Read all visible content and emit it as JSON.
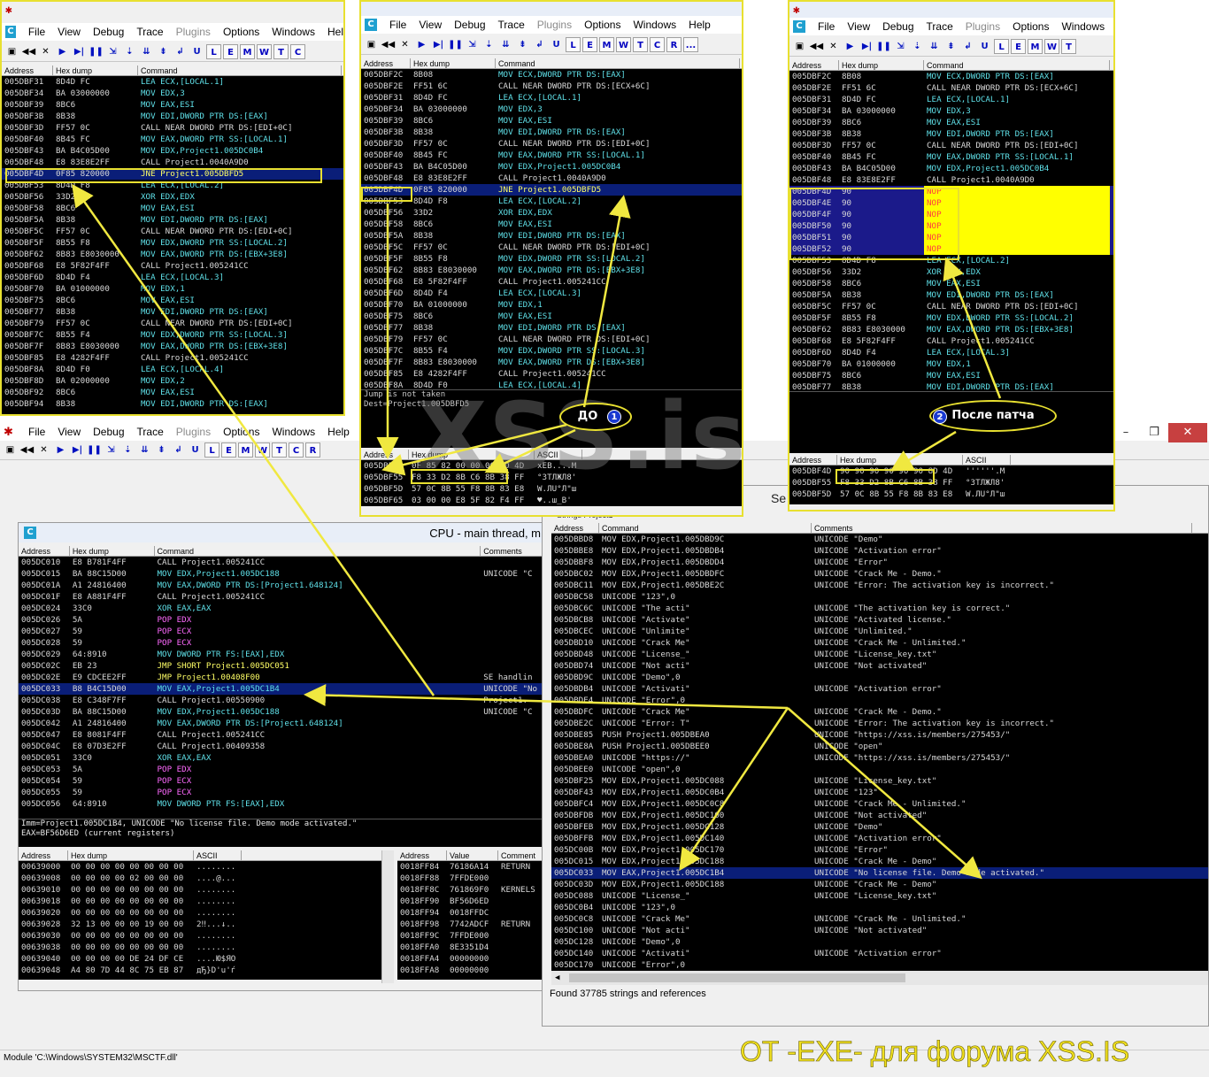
{
  "menu": {
    "file": "File",
    "view": "View",
    "debug": "Debug",
    "trace": "Trace",
    "plugins": "Plugins",
    "options": "Options",
    "windows": "Windows",
    "help": "Help",
    "hel_cut": "Hel"
  },
  "toolbar": {
    "l": "L",
    "e": "E",
    "m": "M",
    "w": "W",
    "t": "T",
    "c": "C",
    "r": "R",
    "k": "K",
    "b": "B",
    "s": "S",
    "dots": "..."
  },
  "headers": {
    "address": "Address",
    "hexdump": "Hex dump",
    "command": "Command",
    "comments": "Comments",
    "ascii": "ASCII",
    "value": "Value",
    "comment": "Comment",
    "strings_tab": "Strings Project1"
  },
  "cpu_title": "CPU - main thread, m",
  "se_cut": "Se",
  "labels": {
    "do_label": "ДО",
    "do_num": "1",
    "after_label": "После патча",
    "after_num": "2"
  },
  "watermark": "XSS.is",
  "footer": {
    "module": "Module 'C:\\Windows\\SYSTEM32\\MSCTF.dll'",
    "found": "Found 37785 strings and references",
    "credit": "ОТ -EXE- для форума XSS.IS"
  },
  "jump_info": {
    "l1": "Jump is not taken",
    "l2": "Dest=Project1.005DBFD5"
  },
  "cpu_info": {
    "l1": "Imm=Project1.005DC1B4, UNICODE \"No license file. Demo mode activated.\"",
    "l2": "EAX=BF56D6ED (current registers)"
  },
  "top_left": [
    [
      "005DBF31",
      "8D4D FC",
      "LEA ECX,[LOCAL.1]"
    ],
    [
      "005DBF34",
      "BA 03000000",
      "MOV EDX,3"
    ],
    [
      "005DBF39",
      "8BC6",
      "MOV EAX,ESI"
    ],
    [
      "005DBF3B",
      "8B38",
      "MOV EDI,DWORD PTR DS:[EAX]"
    ],
    [
      "005DBF3D",
      "FF57 0C",
      "CALL NEAR DWORD PTR DS:[EDI+0C]"
    ],
    [
      "005DBF40",
      "8B45 FC",
      "MOV EAX,DWORD PTR SS:[LOCAL.1]"
    ],
    [
      "005DBF43",
      "BA B4C05D00",
      "MOV EDX,Project1.005DC0B4"
    ],
    [
      "005DBF48",
      "E8 83E8E2FF",
      "CALL Project1.0040A9D0"
    ],
    [
      "005DBF4D",
      "0F85 820000",
      "JNE Project1.005DBFD5"
    ],
    [
      "005DBF53",
      "8D4D F8",
      "LEA ECX,[LOCAL.2]"
    ],
    [
      "005DBF56",
      "33D2",
      "XOR EDX,EDX"
    ],
    [
      "005DBF58",
      "8BC6",
      "MOV EAX,ESI"
    ],
    [
      "005DBF5A",
      "8B38",
      "MOV EDI,DWORD PTR DS:[EAX]"
    ],
    [
      "005DBF5C",
      "FF57 0C",
      "CALL NEAR DWORD PTR DS:[EDI+0C]"
    ],
    [
      "005DBF5F",
      "8B55 F8",
      "MOV EDX,DWORD PTR SS:[LOCAL.2]"
    ],
    [
      "005DBF62",
      "8B83 E8030000",
      "MOV EAX,DWORD PTR DS:[EBX+3E8]"
    ],
    [
      "005DBF68",
      "E8 5F82F4FF",
      "CALL Project1.005241CC"
    ],
    [
      "005DBF6D",
      "8D4D F4",
      "LEA ECX,[LOCAL.3]"
    ],
    [
      "005DBF70",
      "BA 01000000",
      "MOV EDX,1"
    ],
    [
      "005DBF75",
      "8BC6",
      "MOV EAX,ESI"
    ],
    [
      "005DBF77",
      "8B38",
      "MOV EDI,DWORD PTR DS:[EAX]"
    ],
    [
      "005DBF79",
      "FF57 0C",
      "CALL NEAR DWORD PTR DS:[EDI+0C]"
    ],
    [
      "005DBF7C",
      "8B55 F4",
      "MOV EDX,DWORD PTR SS:[LOCAL.3]"
    ],
    [
      "005DBF7F",
      "8B83 E8030000",
      "MOV EAX,DWORD PTR DS:[EBX+3E8]"
    ],
    [
      "005DBF85",
      "E8 4282F4FF",
      "CALL Project1.005241CC"
    ],
    [
      "005DBF8A",
      "8D4D F0",
      "LEA ECX,[LOCAL.4]"
    ],
    [
      "005DBF8D",
      "BA 02000000",
      "MOV EDX,2"
    ],
    [
      "005DBF92",
      "8BC6",
      "MOV EAX,ESI"
    ],
    [
      "005DBF94",
      "8B38",
      "MOV EDI,DWORD PTR DS:[EAX]"
    ]
  ],
  "top_mid": [
    [
      "005DBF2C",
      "8B08",
      "MOV ECX,DWORD PTR DS:[EAX]"
    ],
    [
      "005DBF2E",
      "FF51 6C",
      "CALL NEAR DWORD PTR DS:[ECX+6C]"
    ],
    [
      "005DBF31",
      "8D4D FC",
      "LEA ECX,[LOCAL.1]"
    ],
    [
      "005DBF34",
      "BA 03000000",
      "MOV EDX,3"
    ],
    [
      "005DBF39",
      "8BC6",
      "MOV EAX,ESI"
    ],
    [
      "005DBF3B",
      "8B38",
      "MOV EDI,DWORD PTR DS:[EAX]"
    ],
    [
      "005DBF3D",
      "FF57 0C",
      "CALL NEAR DWORD PTR DS:[EDI+0C]"
    ],
    [
      "005DBF40",
      "8B45 FC",
      "MOV EAX,DWORD PTR SS:[LOCAL.1]"
    ],
    [
      "005DBF43",
      "BA B4C05D00",
      "MOV EDX,Project1.005DC0B4"
    ],
    [
      "005DBF48",
      "E8 83E8E2FF",
      "CALL Project1.0040A9D0"
    ],
    [
      "005DBF4D",
      "0F85 820000",
      "JNE Project1.005DBFD5"
    ],
    [
      "005DBF53",
      "8D4D F8",
      "LEA ECX,[LOCAL.2]"
    ],
    [
      "005DBF56",
      "33D2",
      "XOR EDX,EDX"
    ],
    [
      "005DBF58",
      "8BC6",
      "MOV EAX,ESI"
    ],
    [
      "005DBF5A",
      "8B38",
      "MOV EDI,DWORD PTR DS:[EAX]"
    ],
    [
      "005DBF5C",
      "FF57 0C",
      "CALL NEAR DWORD PTR DS:[EDI+0C]"
    ],
    [
      "005DBF5F",
      "8B55 F8",
      "MOV EDX,DWORD PTR SS:[LOCAL.2]"
    ],
    [
      "005DBF62",
      "8B83 E8030000",
      "MOV EAX,DWORD PTR DS:[EBX+3E8]"
    ],
    [
      "005DBF68",
      "E8 5F82F4FF",
      "CALL Project1.005241CC"
    ],
    [
      "005DBF6D",
      "8D4D F4",
      "LEA ECX,[LOCAL.3]"
    ],
    [
      "005DBF70",
      "BA 01000000",
      "MOV EDX,1"
    ],
    [
      "005DBF75",
      "8BC6",
      "MOV EAX,ESI"
    ],
    [
      "005DBF77",
      "8B38",
      "MOV EDI,DWORD PTR DS:[EAX]"
    ],
    [
      "005DBF79",
      "FF57 0C",
      "CALL NEAR DWORD PTR DS:[EDI+0C]"
    ],
    [
      "005DBF7C",
      "8B55 F4",
      "MOV EDX,DWORD PTR SS:[LOCAL.3]"
    ],
    [
      "005DBF7F",
      "8B83 E8030000",
      "MOV EAX,DWORD PTR DS:[EBX+3E8]"
    ],
    [
      "005DBF85",
      "E8 4282F4FF",
      "CALL Project1.005241CC"
    ],
    [
      "005DBF8A",
      "8D4D F0",
      "LEA ECX,[LOCAL.4]"
    ]
  ],
  "top_mid_dump": [
    [
      "005DBF4D",
      "0F 85 82 00 00 00 8D 4D",
      "xEB....M"
    ],
    [
      "005DBF55",
      "F8 33 D2 8B C6 8B 38 FF",
      "°3ТЛЖЛ8'"
    ],
    [
      "005DBF5D",
      "57 0C 8B 55 F8 8B 83 E8",
      "W.ЛU°Л\"ш"
    ],
    [
      "005DBF65",
      "03 00 00 E8 5F 82 F4 FF",
      "♥..ш_В'"
    ]
  ],
  "top_right": [
    [
      "005DBF2C",
      "8B08",
      "MOV ECX,DWORD PTR DS:[EAX]"
    ],
    [
      "005DBF2E",
      "FF51 6C",
      "CALL NEAR DWORD PTR DS:[ECX+6C]"
    ],
    [
      "005DBF31",
      "8D4D FC",
      "LEA ECX,[LOCAL.1]"
    ],
    [
      "005DBF34",
      "BA 03000000",
      "MOV EDX,3"
    ],
    [
      "005DBF39",
      "8BC6",
      "MOV EAX,ESI"
    ],
    [
      "005DBF3B",
      "8B38",
      "MOV EDI,DWORD PTR DS:[EAX]"
    ],
    [
      "005DBF3D",
      "FF57 0C",
      "CALL NEAR DWORD PTR DS:[EDI+0C]"
    ],
    [
      "005DBF40",
      "8B45 FC",
      "MOV EAX,DWORD PTR SS:[LOCAL.1]"
    ],
    [
      "005DBF43",
      "BA B4C05D00",
      "MOV EDX,Project1.005DC0B4"
    ],
    [
      "005DBF48",
      "E8 83E8E2FF",
      "CALL Project1.0040A9D0"
    ],
    [
      "005DBF4D",
      "90",
      "NOP"
    ],
    [
      "005DBF4E",
      "90",
      "NOP"
    ],
    [
      "005DBF4F",
      "90",
      "NOP"
    ],
    [
      "005DBF50",
      "90",
      "NOP"
    ],
    [
      "005DBF51",
      "90",
      "NOP"
    ],
    [
      "005DBF52",
      "90",
      "NOP"
    ],
    [
      "005DBF53",
      "8D4D F8",
      "LEA ECX,[LOCAL.2]"
    ],
    [
      "005DBF56",
      "33D2",
      "XOR EDX,EDX"
    ],
    [
      "005DBF58",
      "8BC6",
      "MOV EAX,ESI"
    ],
    [
      "005DBF5A",
      "8B38",
      "MOV EDI,DWORD PTR DS:[EAX]"
    ],
    [
      "005DBF5C",
      "FF57 0C",
      "CALL NEAR DWORD PTR DS:[EDI+0C]"
    ],
    [
      "005DBF5F",
      "8B55 F8",
      "MOV EDX,DWORD PTR SS:[LOCAL.2]"
    ],
    [
      "005DBF62",
      "8B83 E8030000",
      "MOV EAX,DWORD PTR DS:[EBX+3E8]"
    ],
    [
      "005DBF68",
      "E8 5F82F4FF",
      "CALL Project1.005241CC"
    ],
    [
      "005DBF6D",
      "8D4D F4",
      "LEA ECX,[LOCAL.3]"
    ],
    [
      "005DBF70",
      "BA 01000000",
      "MOV EDX,1"
    ],
    [
      "005DBF75",
      "8BC6",
      "MOV EAX,ESI"
    ],
    [
      "005DBF77",
      "8B38",
      "MOV EDI,DWORD PTR DS:[EAX]"
    ]
  ],
  "top_right_dump": [
    [
      "005DBF4D",
      "90 90 90 90 90 90 8D 4D",
      "''''''.M"
    ],
    [
      "005DBF55",
      "F8 33 D2 8B C6 8B 38 FF",
      "°3ТЛЖЛ8'"
    ],
    [
      "005DBF5D",
      "57 0C 8B 55 F8 8B 83 E8",
      "W.ЛU°Л\"ш"
    ]
  ],
  "cpu_rows": [
    [
      "005DC010",
      "E8 B781F4FF",
      "CALL Project1.005241CC",
      ""
    ],
    [
      "005DC015",
      "BA 88C15D00",
      "MOV EDX,Project1.005DC188",
      "UNICODE \"C"
    ],
    [
      "005DC01A",
      "A1 24816400",
      "MOV EAX,DWORD PTR DS:[Project1.648124]",
      ""
    ],
    [
      "005DC01F",
      "E8 A881F4FF",
      "CALL Project1.005241CC",
      ""
    ],
    [
      "005DC024",
      "33C0",
      "XOR EAX,EAX",
      ""
    ],
    [
      "005DC026",
      "5A",
      "POP EDX",
      ""
    ],
    [
      "005DC027",
      "59",
      "POP ECX",
      ""
    ],
    [
      "005DC028",
      "59",
      "POP ECX",
      ""
    ],
    [
      "005DC029",
      "64:8910",
      "MOV DWORD PTR FS:[EAX],EDX",
      ""
    ],
    [
      "005DC02C",
      "EB 23",
      "JMP SHORT Project1.005DC051",
      ""
    ],
    [
      "005DC02E",
      "E9 CDCEE2FF",
      "JMP Project1.00408F00",
      "SE handlin"
    ],
    [
      "005DC033",
      "B8 B4C15D00",
      "MOV EAX,Project1.005DC1B4",
      "UNICODE \"No"
    ],
    [
      "005DC038",
      "E8 C348F7FF",
      "CALL Project1.00550900",
      "Project1."
    ],
    [
      "005DC03D",
      "BA 88C15D00",
      "MOV EDX,Project1.005DC188",
      "UNICODE \"C"
    ],
    [
      "005DC042",
      "A1 24816400",
      "MOV EAX,DWORD PTR DS:[Project1.648124]",
      ""
    ],
    [
      "005DC047",
      "E8 8081F4FF",
      "CALL Project1.005241CC",
      ""
    ],
    [
      "005DC04C",
      "E8 07D3E2FF",
      "CALL Project1.00409358",
      ""
    ],
    [
      "005DC051",
      "33C0",
      "XOR EAX,EAX",
      ""
    ],
    [
      "005DC053",
      "5A",
      "POP EDX",
      ""
    ],
    [
      "005DC054",
      "59",
      "POP ECX",
      ""
    ],
    [
      "005DC055",
      "59",
      "POP ECX",
      ""
    ],
    [
      "005DC056",
      "64:8910",
      "MOV DWORD PTR FS:[EAX],EDX",
      ""
    ]
  ],
  "dump_rows": [
    [
      "00639000",
      "00 00 00 00 00 00 00 00",
      "........"
    ],
    [
      "00639008",
      "00 00 00 00 02 00 00 00",
      "....@..."
    ],
    [
      "00639010",
      "00 00 00 00 00 00 00 00",
      "........"
    ],
    [
      "00639018",
      "00 00 00 00 00 00 00 00",
      "........"
    ],
    [
      "00639020",
      "00 00 00 00 00 00 00 00",
      "........"
    ],
    [
      "00639028",
      "32 13 00 00 00 19 00 00",
      "2‼...↓.."
    ],
    [
      "00639030",
      "00 00 00 00 00 00 00 00",
      "........"
    ],
    [
      "00639038",
      "00 00 00 00 00 00 00 00",
      "........"
    ],
    [
      "00639040",
      "00 00 00 00 DE 24 DF CE",
      "....Ю$ЯО"
    ],
    [
      "00639048",
      "A4 80 7D 44 8C 75 EB 87",
      "дЂ}D'u'ѓ"
    ]
  ],
  "stack_rows": [
    [
      "0018FF84",
      "76186A14",
      "RETURN"
    ],
    [
      "0018FF88",
      "7FFDE000",
      ""
    ],
    [
      "0018FF8C",
      "761869F0",
      "KERNELS"
    ],
    [
      "0018FF90",
      "BF56D6ED",
      ""
    ],
    [
      "0018FF94",
      "0018FFDC",
      ""
    ],
    [
      "0018FF98",
      "7742ADCF",
      "RETURN"
    ],
    [
      "0018FF9C",
      "7FFDE000",
      ""
    ],
    [
      "0018FFA0",
      "8E3351D4",
      ""
    ],
    [
      "0018FFA4",
      "00000000",
      ""
    ],
    [
      "0018FFA8",
      "00000000",
      ""
    ]
  ],
  "strings_rows": [
    [
      "005DBBD8",
      "MOV EDX,Project1.005DBD9C",
      "UNICODE \"Demo\""
    ],
    [
      "005DBBE8",
      "MOV EDX,Project1.005DBDB4",
      "UNICODE \"Activation error\""
    ],
    [
      "005DBBF8",
      "MOV EDX,Project1.005DBDD4",
      "UNICODE \"Error\""
    ],
    [
      "005DBC02",
      "MOV EDX,Project1.005DBDFC",
      "UNICODE \"Crack Me - Demo.\""
    ],
    [
      "005DBC11",
      "MOV EDX,Project1.005DBE2C",
      "UNICODE \"Error: The activation key is incorrect.\""
    ],
    [
      "005DBC58",
      "UNICODE \"123\",0",
      ""
    ],
    [
      "005DBC6C",
      "UNICODE \"The acti\"",
      "UNICODE \"The activation key is correct.\""
    ],
    [
      "005DBCB8",
      "UNICODE \"Activate\"",
      "UNICODE \"Activated license.\""
    ],
    [
      "005DBCEC",
      "UNICODE \"Unlimite\"",
      "UNICODE \"Unlimited.\""
    ],
    [
      "005DBD10",
      "UNICODE \"Crack Me\"",
      "UNICODE \"Crack Me - Unlimited.\""
    ],
    [
      "005DBD48",
      "UNICODE \"License_\"",
      "UNICODE \"License_key.txt\""
    ],
    [
      "005DBD74",
      "UNICODE \"Not acti\"",
      "UNICODE \"Not activated\""
    ],
    [
      "005DBD9C",
      "UNICODE \"Demo\",0",
      ""
    ],
    [
      "005DBDB4",
      "UNICODE \"Activati\"",
      "UNICODE \"Activation error\""
    ],
    [
      "005DBDE4",
      "UNICODE \"Error\",0",
      ""
    ],
    [
      "005DBDFC",
      "UNICODE \"Crack Me\"",
      "UNICODE \"Crack Me - Demo.\""
    ],
    [
      "005DBE2C",
      "UNICODE \"Error: T\"",
      "UNICODE \"Error: The activation key is incorrect.\""
    ],
    [
      "005DBE85",
      "PUSH Project1.005DBEA0",
      "UNICODE \"https://xss.is/members/275453/\""
    ],
    [
      "005DBE8A",
      "PUSH Project1.005DBEE0",
      "UNICODE \"open\""
    ],
    [
      "005DBEA0",
      "UNICODE \"https://\"",
      "UNICODE \"https://xss.is/members/275453/\""
    ],
    [
      "005DBEE0",
      "UNICODE \"open\",0",
      ""
    ],
    [
      "005DBF25",
      "MOV EDX,Project1.005DC088",
      "UNICODE \"License_key.txt\""
    ],
    [
      "005DBF43",
      "MOV EDX,Project1.005DC0B4",
      "UNICODE \"123\""
    ],
    [
      "005DBFC4",
      "MOV EDX,Project1.005DC0C8",
      "UNICODE \"Crack Me - Unlimited.\""
    ],
    [
      "005DBFDB",
      "MOV EDX,Project1.005DC100",
      "UNICODE \"Not activated\""
    ],
    [
      "005DBFEB",
      "MOV EDX,Project1.005DC128",
      "UNICODE \"Demo\""
    ],
    [
      "005DBFFB",
      "MOV EDX,Project1.005DC140",
      "UNICODE \"Activation error\""
    ],
    [
      "005DC00B",
      "MOV EDX,Project1.005DC170",
      "UNICODE \"Error\""
    ],
    [
      "005DC015",
      "MOV EDX,Project1.005DC188",
      "UNICODE \"Crack Me - Demo\""
    ],
    [
      "005DC033",
      "MOV EAX,Project1.005DC1B4",
      "UNICODE \"No license file. Demo mode activated.\""
    ],
    [
      "005DC03D",
      "MOV EDX,Project1.005DC188",
      "UNICODE \"Crack Me - Demo\""
    ],
    [
      "005DC088",
      "UNICODE \"License_\"",
      "UNICODE \"License_key.txt\""
    ],
    [
      "005DC0B4",
      "UNICODE \"123\",0",
      ""
    ],
    [
      "005DC0C8",
      "UNICODE \"Crack Me\"",
      "UNICODE \"Crack Me - Unlimited.\""
    ],
    [
      "005DC100",
      "UNICODE \"Not acti\"",
      "UNICODE \"Not activated\""
    ],
    [
      "005DC128",
      "UNICODE \"Demo\",0",
      ""
    ],
    [
      "005DC140",
      "UNICODE \"Activati\"",
      "UNICODE \"Activation error\""
    ],
    [
      "005DC170",
      "UNICODE \"Error\",0",
      ""
    ]
  ]
}
